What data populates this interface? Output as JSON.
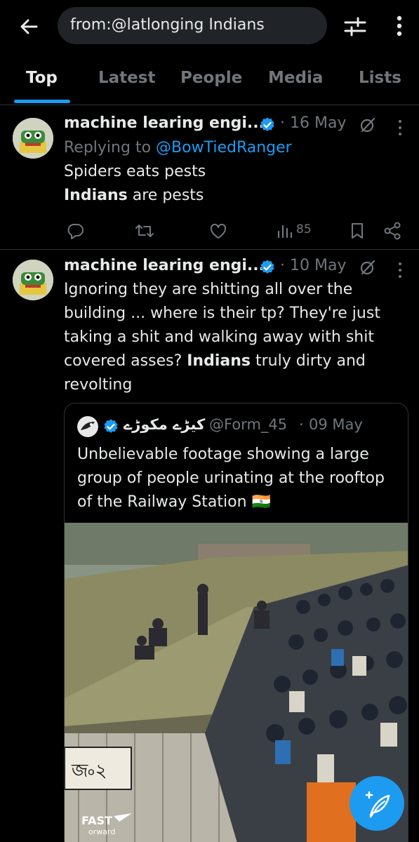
{
  "search": {
    "query": "from:@latlonging Indians"
  },
  "tabs": [
    {
      "label": "Top",
      "active": true
    },
    {
      "label": "Latest"
    },
    {
      "label": "People"
    },
    {
      "label": "Media"
    },
    {
      "label": "Lists"
    }
  ],
  "tweets": [
    {
      "author": "machine learing engi...",
      "date_sep": "·",
      "date": "16 May",
      "reply_prefix": "Replying to",
      "reply_handle": "@BowTiedRanger",
      "line1": "Spiders eats pests",
      "line2_bold": "Indians",
      "line2_rest": " are pests",
      "views": "85"
    },
    {
      "author": "machine learing engi...",
      "date_sep": "·",
      "date": "10 May",
      "text_before": "Ignoring they are shitting all over the building ... where is their tp? They're just taking a shit and walking away with shit covered asses? ",
      "text_bold": "Indians",
      "text_after": " truly dirty and revolting",
      "quote": {
        "name": "کیڑے مکوڑے",
        "handle": "@Form_45",
        "date_sep": "·",
        "date": "09 May",
        "text": "Unbelievable footage showing a large group of people urinating at the rooftop of the Railway Station",
        "flag": "🇮🇳",
        "media_sign": "জ৹২",
        "watermark_line1": "FAST",
        "watermark_line2": "orward"
      }
    }
  ],
  "colors": {
    "background": "#000000",
    "accent": "#1d9bf0",
    "text_primary": "#e7e9ea",
    "text_secondary": "#71767b",
    "divider": "#2f3336"
  },
  "icons": [
    "back-arrow-icon",
    "filter-sliders-icon",
    "more-vertical-icon",
    "verified-badge-icon",
    "grok-icon",
    "reply-icon",
    "retweet-icon",
    "like-icon",
    "views-icon",
    "bookmark-icon",
    "share-icon",
    "compose-icon"
  ]
}
